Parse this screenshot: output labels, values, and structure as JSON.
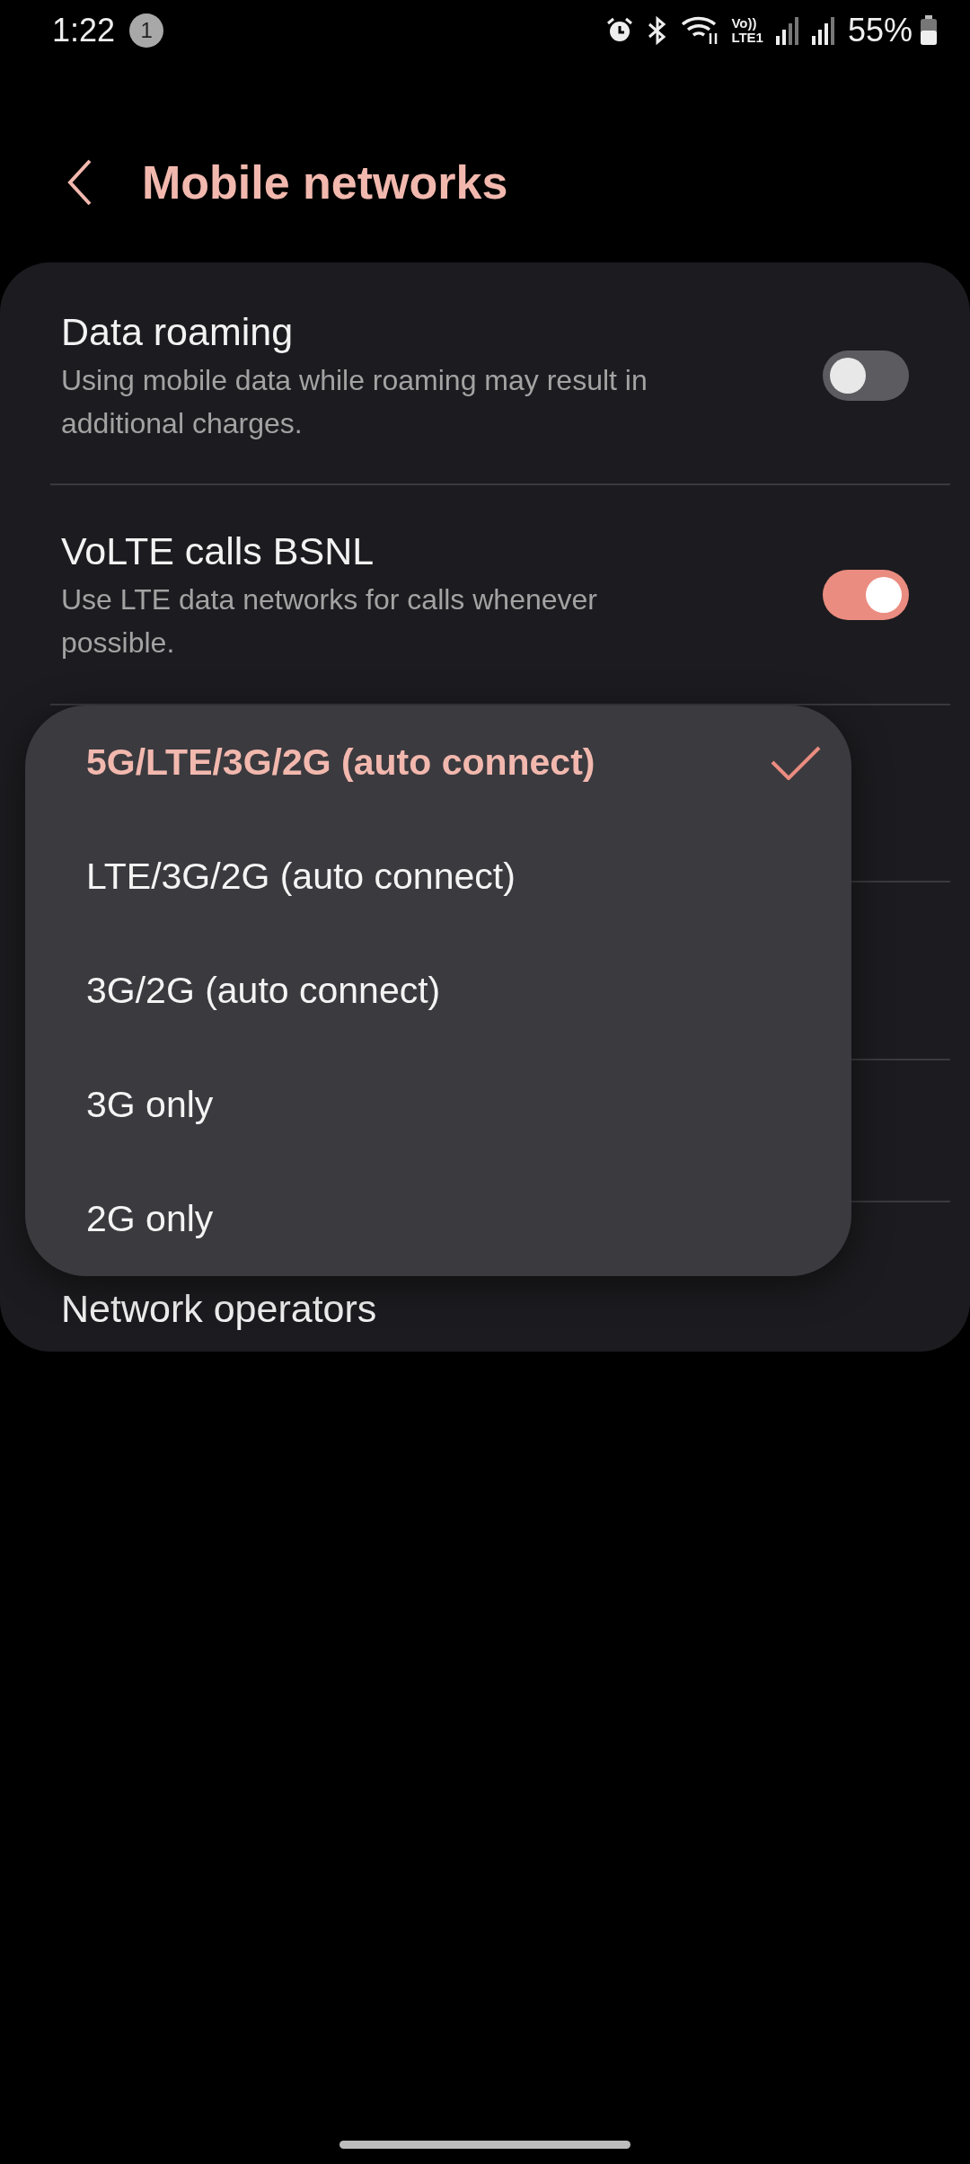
{
  "status_bar": {
    "time": "1:22",
    "notification_count": "1",
    "volte_top": "Vo))",
    "volte_bottom": "LTE1",
    "battery": "55%"
  },
  "header": {
    "title": "Mobile networks"
  },
  "settings": [
    {
      "kind": "toggle",
      "title": "Data roaming",
      "subtitle": "Using mobile data while roaming may result in additional charges.",
      "on": false
    },
    {
      "kind": "toggle",
      "title": "VoLTE calls BSNL",
      "subtitle": "Use LTE data networks for calls whenever possible.",
      "on": true
    },
    {
      "kind": "hidden"
    },
    {
      "kind": "hidden"
    },
    {
      "kind": "hidden"
    },
    {
      "kind": "plain",
      "title": "Network operators"
    }
  ],
  "network_mode_menu": {
    "options": [
      {
        "label": "5G/LTE/3G/2G (auto connect)",
        "selected": true
      },
      {
        "label": "LTE/3G/2G (auto connect)",
        "selected": false
      },
      {
        "label": "3G/2G (auto connect)",
        "selected": false
      },
      {
        "label": "3G only",
        "selected": false
      },
      {
        "label": "2G only",
        "selected": false
      }
    ]
  }
}
